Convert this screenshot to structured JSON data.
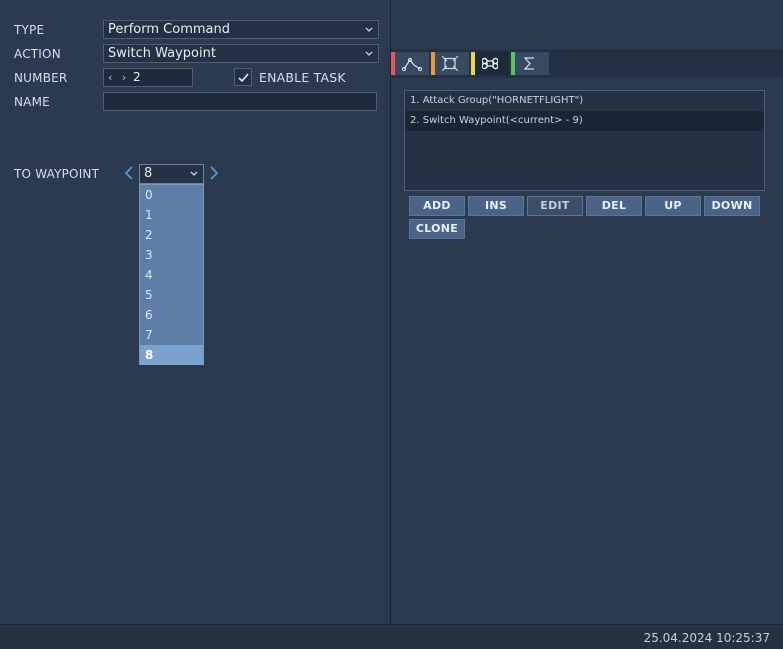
{
  "form": {
    "type_label": "TYPE",
    "type_value": "Perform Command",
    "action_label": "ACTION",
    "action_value": "Switch Waypoint",
    "number_label": "NUMBER",
    "number_value": "2",
    "enable_task_label": "ENABLE TASK",
    "enable_task_checked": true,
    "name_label": "NAME",
    "name_value": ""
  },
  "waypoint": {
    "label": "TO WAYPOINT",
    "selected": "8",
    "options": [
      "0",
      "1",
      "2",
      "3",
      "4",
      "5",
      "6",
      "7",
      "8"
    ]
  },
  "tabs": [
    {
      "icon": "route-icon",
      "color": "#e05a5a",
      "active": false
    },
    {
      "icon": "target-icon",
      "color": "#e89a3c",
      "active": false
    },
    {
      "icon": "command-icon",
      "color": "#e6d84a",
      "active": true
    },
    {
      "icon": "sigma-icon",
      "color": "#5cc45c",
      "active": false
    }
  ],
  "tasks": [
    {
      "text": "1. Attack Group(\"HORNETFLIGHT\")",
      "selected": false
    },
    {
      "text": "2. Switch Waypoint(<current> - 9)",
      "selected": true
    }
  ],
  "buttons": {
    "add": "ADD",
    "ins": "INS",
    "edit": "EDIT",
    "del": "DEL",
    "up": "UP",
    "down": "DOWN",
    "clone": "CLONE"
  },
  "status": {
    "datetime": "25.04.2024 10:25:37"
  }
}
